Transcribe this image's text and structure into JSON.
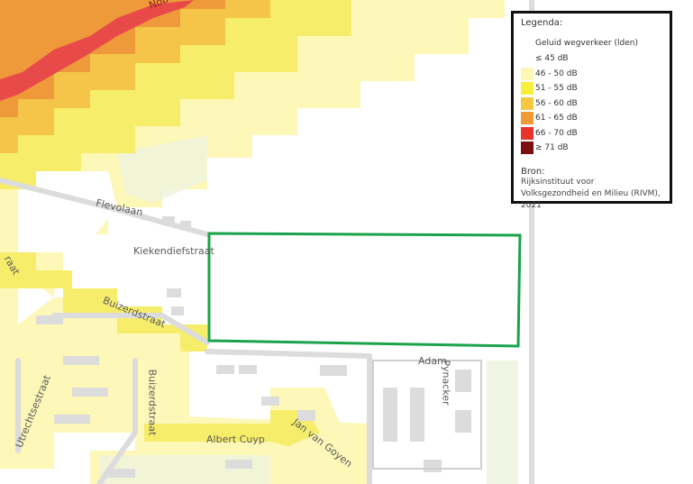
{
  "legend": {
    "title": "Legenda:",
    "subtitle": "Geluid wegverkeer (lden)",
    "classes": [
      {
        "label": "≤ 45 dB",
        "color": "#ffffff"
      },
      {
        "label": "46 - 50 dB",
        "color": "#fdf7b8"
      },
      {
        "label": "51 - 55 dB",
        "color": "#f7f03a"
      },
      {
        "label": "56 - 60 dB",
        "color": "#f5c842"
      },
      {
        "label": "61 - 65 dB",
        "color": "#ef9a35"
      },
      {
        "label": "66 - 70 dB",
        "color": "#e8322a"
      },
      {
        "label": "≥ 71 dB",
        "color": "#7a1010"
      }
    ],
    "source_title": "Bron:",
    "source_text": "Rijksinstituut voor Volksgezondheid en Milieu (RIVM), 2021"
  },
  "streets": {
    "nob": "Nob",
    "flevolaan": "Flevolaan",
    "kiekendiefstraat": "Kiekendiefstraat",
    "buizerdstraat_1": "Buizerdstraat",
    "buizerdstraat_2": "Buizerdstraat",
    "utrechtsestraat": "Utrechtsestraat",
    "albert_cuyp": "Albert Cuyp",
    "jan_van_goyen": "Jan van Goyen",
    "adam": "Adam",
    "pynacker": "Pynacker",
    "raat": "raat"
  },
  "highlight_color": "#1aa34a"
}
